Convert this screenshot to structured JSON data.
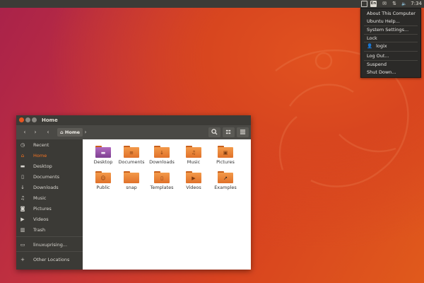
{
  "panel": {
    "time": "7:34",
    "indicators": [
      {
        "name": "indicator-box-icon",
        "glyph": "□"
      },
      {
        "name": "keyboard-icon",
        "glyph": "En"
      },
      {
        "name": "mail-icon",
        "glyph": "✉"
      },
      {
        "name": "network-icon",
        "glyph": "⇅"
      },
      {
        "name": "volume-icon",
        "glyph": "🔈"
      }
    ]
  },
  "menu": {
    "items": [
      {
        "label": "About This Computer"
      },
      {
        "label": "Ubuntu Help..."
      },
      {
        "label": "System Settings..."
      },
      {
        "label": "Lock"
      },
      {
        "label": "logix"
      },
      {
        "label": "Log Out..."
      },
      {
        "label": "Suspend"
      },
      {
        "label": "Shut Down..."
      }
    ]
  },
  "window": {
    "title": "Home",
    "breadcrumb": "Home",
    "colors": {
      "accent": "#f47421",
      "folder": "#e8772e"
    },
    "sidebar": [
      {
        "label": "Recent",
        "icon": "clock-icon",
        "glyph": "◷"
      },
      {
        "label": "Home",
        "icon": "home-icon",
        "glyph": "⌂",
        "active": true
      },
      {
        "label": "Desktop",
        "icon": "desktop-icon",
        "glyph": "▬"
      },
      {
        "label": "Documents",
        "icon": "document-icon",
        "glyph": "▯"
      },
      {
        "label": "Downloads",
        "icon": "download-icon",
        "glyph": "↓"
      },
      {
        "label": "Music",
        "icon": "music-icon",
        "glyph": "♫"
      },
      {
        "label": "Pictures",
        "icon": "camera-icon",
        "glyph": "◙"
      },
      {
        "label": "Videos",
        "icon": "video-icon",
        "glyph": "▶"
      },
      {
        "label": "Trash",
        "icon": "trash-icon",
        "glyph": "▥"
      },
      {
        "label": "linuxuprising...",
        "icon": "drive-icon",
        "glyph": "▭"
      },
      {
        "label": "Other Locations",
        "icon": "plus-icon",
        "glyph": "+"
      }
    ],
    "folders": [
      {
        "label": "Desktop",
        "emblem": "▬"
      },
      {
        "label": "Documents",
        "emblem": "≡"
      },
      {
        "label": "Downloads",
        "emblem": "↓"
      },
      {
        "label": "Music",
        "emblem": "♫"
      },
      {
        "label": "Pictures",
        "emblem": "▣"
      },
      {
        "label": "Public",
        "emblem": "☺"
      },
      {
        "label": "snap",
        "emblem": ""
      },
      {
        "label": "Templates",
        "emblem": "▯"
      },
      {
        "label": "Videos",
        "emblem": "▶"
      },
      {
        "label": "Examples",
        "emblem": "↗"
      }
    ]
  }
}
